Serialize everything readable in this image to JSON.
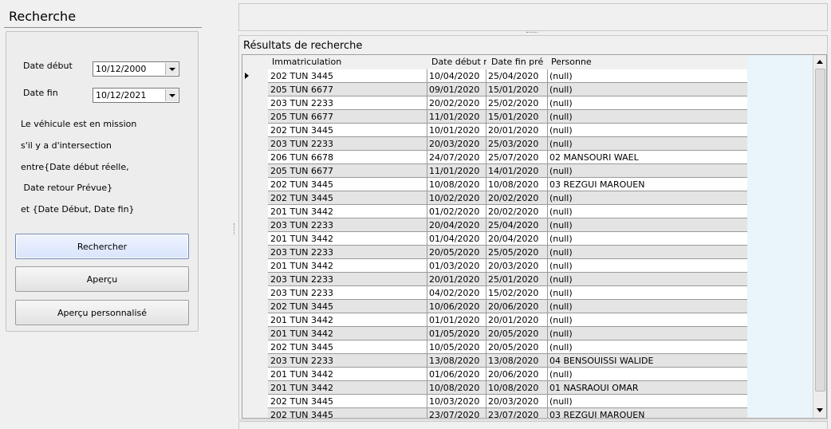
{
  "left": {
    "title": "Recherche",
    "date_debut_label": "Date début",
    "date_debut_value": "10/12/2000",
    "date_fin_label": "Date fin",
    "date_fin_value": "10/12/2021",
    "info_lines": [
      "Le véhicule est en mission",
      "s'il y a d'intersection",
      "entre{Date début réelle,",
      " Date retour Prévue}",
      "et {Date Début, Date fin}"
    ],
    "buttons": {
      "rechercher": "Rechercher",
      "apercu": "Aperçu",
      "apercu_perso": "Aperçu personnalisé"
    }
  },
  "results": {
    "title": "Résultats de recherche",
    "columns": [
      "Immatriculation",
      "Date début r",
      "Date fin pré",
      "Personne"
    ],
    "rows": [
      [
        "202 TUN 3445",
        "10/04/2020",
        "25/04/2020",
        "(null)"
      ],
      [
        "205 TUN 6677",
        "09/01/2020",
        "15/01/2020",
        "(null)"
      ],
      [
        "203 TUN 2233",
        "20/02/2020",
        "25/02/2020",
        "(null)"
      ],
      [
        "205 TUN 6677",
        "11/01/2020",
        "15/01/2020",
        "(null)"
      ],
      [
        "202 TUN 3445",
        "10/01/2020",
        "20/01/2020",
        "(null)"
      ],
      [
        "203 TUN 2233",
        "20/03/2020",
        "25/03/2020",
        "(null)"
      ],
      [
        "206 TUN 6678",
        "24/07/2020",
        "25/07/2020",
        "02 MANSOURI WAEL"
      ],
      [
        "205 TUN 6677",
        "11/01/2020",
        "14/01/2020",
        "(null)"
      ],
      [
        "202 TUN 3445",
        "10/08/2020",
        "10/08/2020",
        "03 REZGUI MAROUEN"
      ],
      [
        "202 TUN 3445",
        "10/02/2020",
        "20/02/2020",
        "(null)"
      ],
      [
        "201 TUN 3442",
        "01/02/2020",
        "20/02/2020",
        "(null)"
      ],
      [
        "203 TUN 2233",
        "20/04/2020",
        "25/04/2020",
        "(null)"
      ],
      [
        "201 TUN 3442",
        "01/04/2020",
        "20/04/2020",
        "(null)"
      ],
      [
        "203 TUN 2233",
        "20/05/2020",
        "25/05/2020",
        "(null)"
      ],
      [
        "201 TUN 3442",
        "01/03/2020",
        "20/03/2020",
        "(null)"
      ],
      [
        "203 TUN 2233",
        "20/01/2020",
        "25/01/2020",
        "(null)"
      ],
      [
        "203 TUN 2233",
        "04/02/2020",
        "15/02/2020",
        "(null)"
      ],
      [
        "202 TUN 3445",
        "10/06/2020",
        "20/06/2020",
        "(null)"
      ],
      [
        "201 TUN 3442",
        "01/01/2020",
        "20/01/2020",
        "(null)"
      ],
      [
        "201 TUN 3442",
        "01/05/2020",
        "20/05/2020",
        "(null)"
      ],
      [
        "202 TUN 3445",
        "10/05/2020",
        "20/05/2020",
        "(null)"
      ],
      [
        "203 TUN 2233",
        "13/08/2020",
        "13/08/2020",
        "04 BENSOUISSI WALIDE"
      ],
      [
        "201 TUN 3442",
        "01/06/2020",
        "20/06/2020",
        "(null)"
      ],
      [
        "201 TUN 3442",
        "10/08/2020",
        "10/08/2020",
        "01 NASRAOUI OMAR"
      ],
      [
        "202 TUN 3445",
        "10/03/2020",
        "20/03/2020",
        "(null)"
      ],
      [
        "202 TUN 3445",
        "23/07/2020",
        "23/07/2020",
        "03 REZGUI MAROUEN"
      ]
    ]
  },
  "icons": {
    "combo_arrow": "chevron-down-icon",
    "row_pointer": "row-pointer-icon",
    "scroll_up": "scroll-up-icon",
    "scroll_down": "scroll-down-icon"
  },
  "colors": {
    "grid_background": "#eaf4fb",
    "primary_button": "#d9e4fb"
  }
}
